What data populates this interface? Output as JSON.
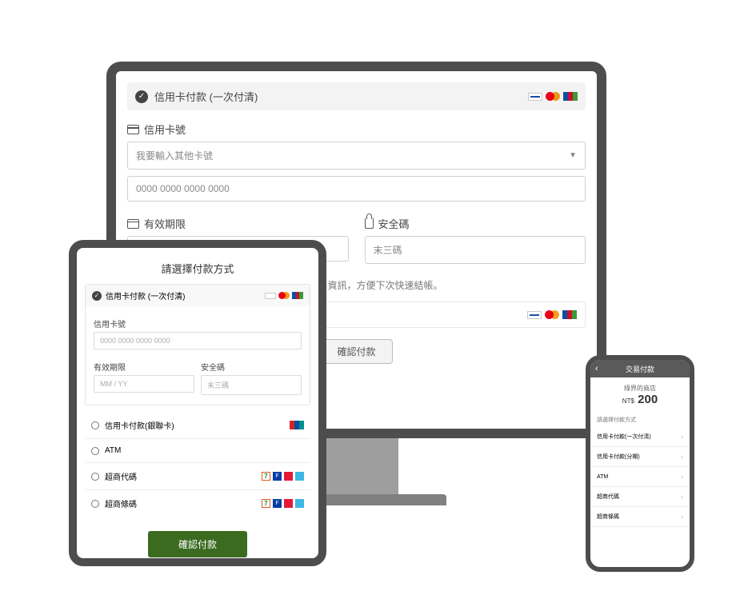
{
  "desktop": {
    "header_title": "信用卡付款 (一次付清)",
    "card_section_label": "信用卡號",
    "card_select_text": "我要輸入其他卡號",
    "card_number_placeholder": "0000 0000 0000 0000",
    "expiry_label": "有效期限",
    "cvv_label": "安全碼",
    "cvv_placeholder": "末三碼",
    "tip_text": "記住本次交易資訊，方便下次快速結帳。",
    "confirm_label": "確認付款"
  },
  "tablet": {
    "title": "請選擇付款方式",
    "header_title": "信用卡付款 (一次付清)",
    "card_label": "信用卡號",
    "card_placeholder": "0000 0000 0000 0000",
    "expiry_label": "有效期限",
    "expiry_placeholder": "MM / YY",
    "cvv_label": "安全碼",
    "cvv_placeholder": "末三碼",
    "options": [
      "信用卡付款(銀聯卡)",
      "ATM",
      "超商代碼",
      "超商條碼"
    ],
    "confirm_label": "確認付款"
  },
  "phone": {
    "topbar_title": "交易付款",
    "store_name": "綠界的商店",
    "currency": "NT$",
    "amount": "200",
    "subtitle": "請選擇付款方式",
    "items": [
      "信用卡付款(一次付清)",
      "信用卡付款(分期)",
      "ATM",
      "超商代碼",
      "超商條碼"
    ]
  }
}
